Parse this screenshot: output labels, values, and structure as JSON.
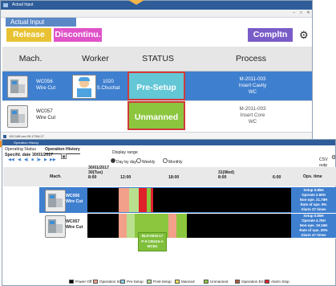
{
  "win1": {
    "title": "Actual Input",
    "subtitle": "Actual Input",
    "buttons": {
      "release": "Release",
      "discontinue": "Discontinu.",
      "complete": "Compltn"
    },
    "columns": [
      "Mach.",
      "Worker",
      "STATUS",
      "Process"
    ],
    "rows": [
      {
        "machine": "WC056",
        "machine_type": "Wire Cut",
        "worker_id": "1020",
        "worker_name": "S.Chuchat",
        "status": "Pre-Setup",
        "process_1": "M-2011-003",
        "process_2": "Insert Cavity",
        "process_3": "WC"
      },
      {
        "machine": "WC057",
        "machine_type": "Wire Cut",
        "worker_id": "",
        "worker_name": "",
        "status": "Unmanned",
        "process_1": "M-2011-003",
        "process_2": "Insert Core",
        "process_3": "WC"
      }
    ],
    "footer_text": "192.168.xxx 00:17/04:17"
  },
  "win2": {
    "title": "Operation History",
    "tabs": [
      "Operating Status",
      "Operation History"
    ],
    "specified_date_label": "Specifd. date",
    "specified_date": "30/01/2017",
    "display_range_label": "Display range",
    "range_options": [
      "Day by day",
      "Weekly",
      "Monthly"
    ],
    "csv_label": "CSV outp",
    "header": {
      "mach": "Mach.",
      "date_left": "30/01/2017",
      "date_left2": "30(Tue)",
      "date_right": "31(Wed)",
      "ops_time": "Ops. time"
    },
    "time_ticks": [
      "8:00",
      "12:00",
      "18:00",
      "8:00",
      "6:00"
    ],
    "rows": [
      {
        "machine": "WC056",
        "machine_type": "Wire Cut",
        "ops": [
          "Setup 0.85H",
          "Operate 2.60H",
          "Non-ope. 21.78H",
          "Rate of ope. 9%",
          "Alarm 37 times"
        ]
      },
      {
        "machine": "WC057",
        "machine_type": "Wire Cut",
        "ops": [
          "Setup 0.85H",
          "Operate 4.78H",
          "Non-ope. 19.16H",
          "Rate of ope. 20%",
          "Alarm 47 times"
        ]
      }
    ],
    "tooltip": [
      "BLR-0915-17",
      "P-0-135415-A",
      "WCB1"
    ],
    "legend": [
      {
        "label": "Power Off",
        "color": "#000000"
      },
      {
        "label": "Operation Stop",
        "color": "#f2a08a"
      },
      {
        "label": "Pre-Setup",
        "color": "#8ed1e6"
      },
      {
        "label": "Post-Setup",
        "color": "#b9e08e"
      },
      {
        "label": "Manned",
        "color": "#f2e25a"
      },
      {
        "label": "Unmanned",
        "color": "#8cc63f"
      },
      {
        "label": "Operation Error",
        "color": "#b05a3a"
      },
      {
        "label": "Alarm Stop",
        "color": "#e0202a"
      }
    ]
  },
  "colors": {
    "release": "#e8c233",
    "discontinue": "#e052c8",
    "complete": "#7a5cc8",
    "selected_row": "#3f7fcf",
    "pre_setup": "#63c7d6",
    "unmanned": "#8cc63f",
    "status_border": "#d13a3a"
  }
}
